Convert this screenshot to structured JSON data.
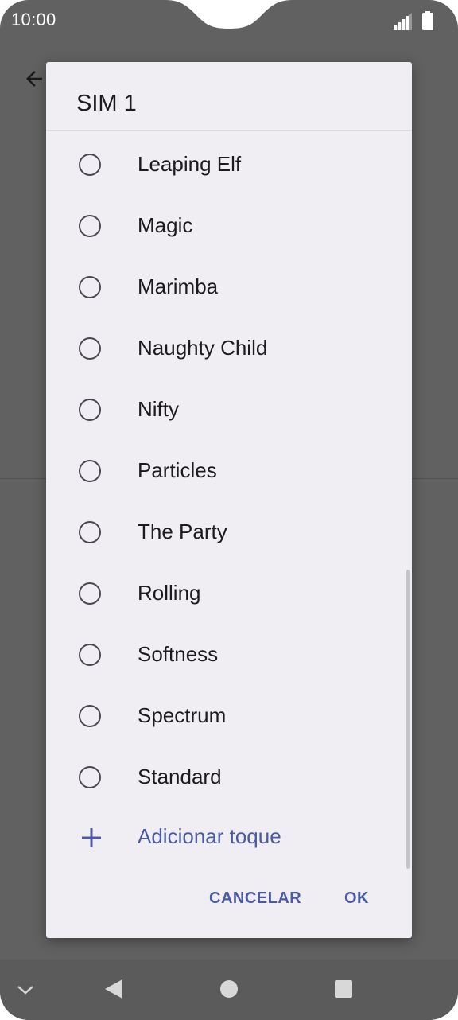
{
  "status_bar": {
    "time": "10:00"
  },
  "dialog": {
    "title": "SIM 1",
    "items": [
      {
        "label": "Leaping Elf",
        "selected": false
      },
      {
        "label": "Magic",
        "selected": false
      },
      {
        "label": "Marimba",
        "selected": false
      },
      {
        "label": "Naughty Child",
        "selected": false
      },
      {
        "label": "Nifty",
        "selected": false
      },
      {
        "label": "Particles",
        "selected": false
      },
      {
        "label": "The Party",
        "selected": false
      },
      {
        "label": "Rolling",
        "selected": false
      },
      {
        "label": "Softness",
        "selected": false
      },
      {
        "label": "Spectrum",
        "selected": false
      },
      {
        "label": "Standard",
        "selected": false
      }
    ],
    "add_label": "Adicionar toque",
    "cancel_label": "CANCELAR",
    "ok_label": "OK"
  },
  "colors": {
    "accent": "#4a5aa3",
    "scrim": "#616161",
    "dialog_bg": "#f1eef3"
  },
  "icons": {
    "background_back": "arrow-left-icon",
    "signal": "signal-icon",
    "battery": "battery-icon",
    "add": "plus-icon",
    "nav": [
      "chevron-down-icon",
      "back-triangle-icon",
      "home-circle-icon",
      "recents-square-icon"
    ]
  }
}
